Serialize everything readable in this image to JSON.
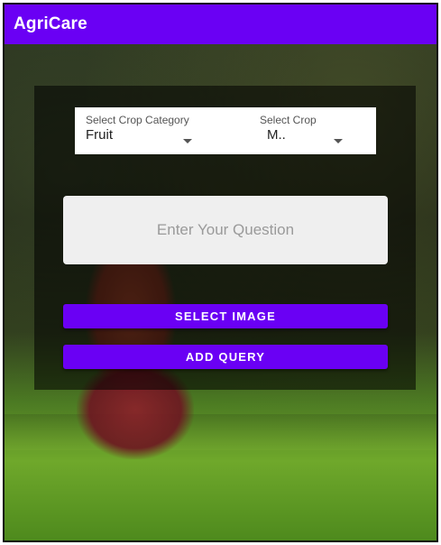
{
  "app": {
    "title": "AgriCare"
  },
  "crop_category": {
    "label": "Select Crop Category",
    "value": "Fruit"
  },
  "crop": {
    "label": "Select Crop",
    "value": "M.."
  },
  "question": {
    "placeholder": "Enter Your Question"
  },
  "buttons": {
    "select_image": "SELECT IMAGE",
    "add_query": "ADD QUERY"
  },
  "colors": {
    "accent": "#6a00f4",
    "panel_overlay": "#000000"
  }
}
